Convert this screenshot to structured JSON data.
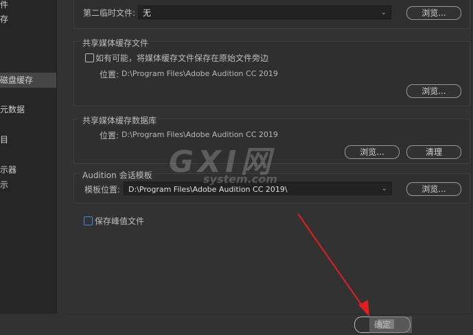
{
  "sidebar": {
    "items": [
      {
        "label": "件"
      },
      {
        "label": "存"
      },
      {
        "label": "磁盘缓存"
      },
      {
        "label": "元数据"
      },
      {
        "label": "目"
      },
      {
        "label": "示器"
      },
      {
        "label": "示"
      }
    ]
  },
  "secondary_temp": {
    "label": "第二临时文件:",
    "value": "无",
    "browse": "浏览..."
  },
  "media_cache_files": {
    "title": "共享媒体缓存文件",
    "checkbox_label": "如有可能，将媒体缓存文件保存在原始文件旁边",
    "location_label": "位置:",
    "location_value": "D:\\Program Files\\Adobe Audition CC 2019",
    "browse": "浏览..."
  },
  "media_cache_db": {
    "title": "共享媒体缓存数据库",
    "location_label": "位置:",
    "location_value": "D:\\Program Files\\Adobe Audition CC 2019",
    "browse": "浏览...",
    "clean": "清理"
  },
  "session_template": {
    "title": "Audition 会话模板",
    "location_label": "模板位置:",
    "location_value": "D:\\Program Files\\Adobe Audition CC 2019\\",
    "browse": "浏览..."
  },
  "save_peak": {
    "label": "保存峰值文件"
  },
  "footer": {
    "ok": "确定"
  },
  "watermark": {
    "line1": "GXI网",
    "line2": "system.com"
  },
  "colors": {
    "background": "#323232",
    "sidebar": "#262626",
    "selected": "#454545",
    "checkbox_accent": "#3a8fe0",
    "arrow": "#e02020"
  }
}
